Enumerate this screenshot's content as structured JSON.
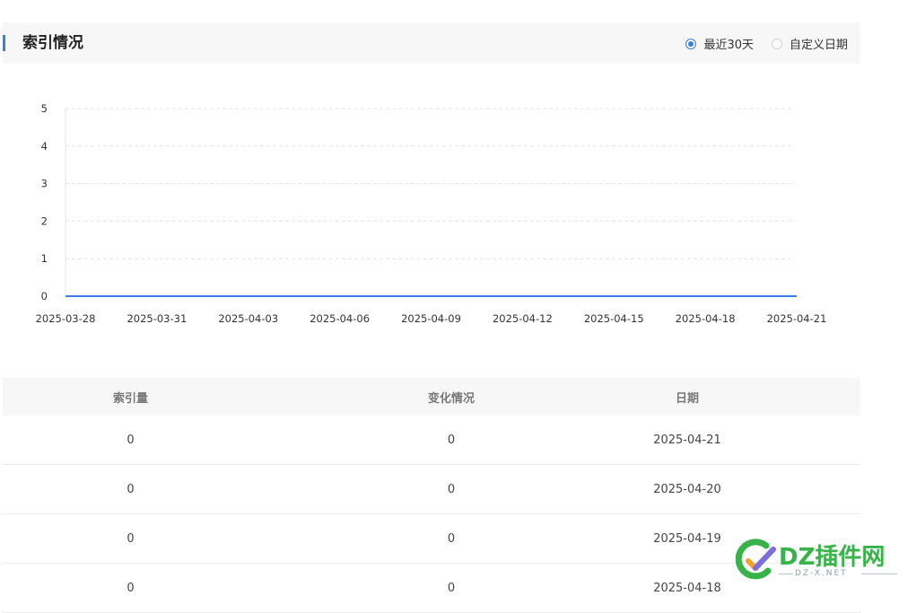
{
  "header": {
    "title": "索引情况",
    "range_options": [
      {
        "label": "最近30天",
        "selected": true
      },
      {
        "label": "自定义日期",
        "selected": false
      }
    ]
  },
  "colors": {
    "accent": "#3a7ce8",
    "line": "#3a7ce8",
    "grid": "#e3e3e3",
    "watermark_green": "#37b34a"
  },
  "chart_data": {
    "type": "line",
    "x_tick_labels": [
      "2025-03-28",
      "2025-03-31",
      "2025-04-03",
      "2025-04-06",
      "2025-04-09",
      "2025-04-12",
      "2025-04-15",
      "2025-04-18",
      "2025-04-21"
    ],
    "y_tick_labels": [
      "0",
      "1",
      "2",
      "3",
      "4",
      "5"
    ],
    "ylim": [
      0,
      5
    ],
    "x_start": "2025-03-28",
    "x_end": "2025-04-21",
    "series": [
      {
        "values": [
          0,
          0,
          0,
          0,
          0,
          0,
          0,
          0,
          0,
          0,
          0,
          0,
          0,
          0,
          0,
          0,
          0,
          0,
          0,
          0,
          0,
          0,
          0,
          0,
          0
        ]
      }
    ],
    "grid": true
  },
  "table": {
    "headers": [
      "索引量",
      "变化情况",
      "日期"
    ],
    "rows": [
      [
        "0",
        "0",
        "2025-04-21"
      ],
      [
        "0",
        "0",
        "2025-04-20"
      ],
      [
        "0",
        "0",
        "2025-04-19"
      ],
      [
        "0",
        "0",
        "2025-04-18"
      ]
    ]
  },
  "watermark": {
    "brand": "DZ插件网",
    "domain": "DZ-X.NET"
  }
}
